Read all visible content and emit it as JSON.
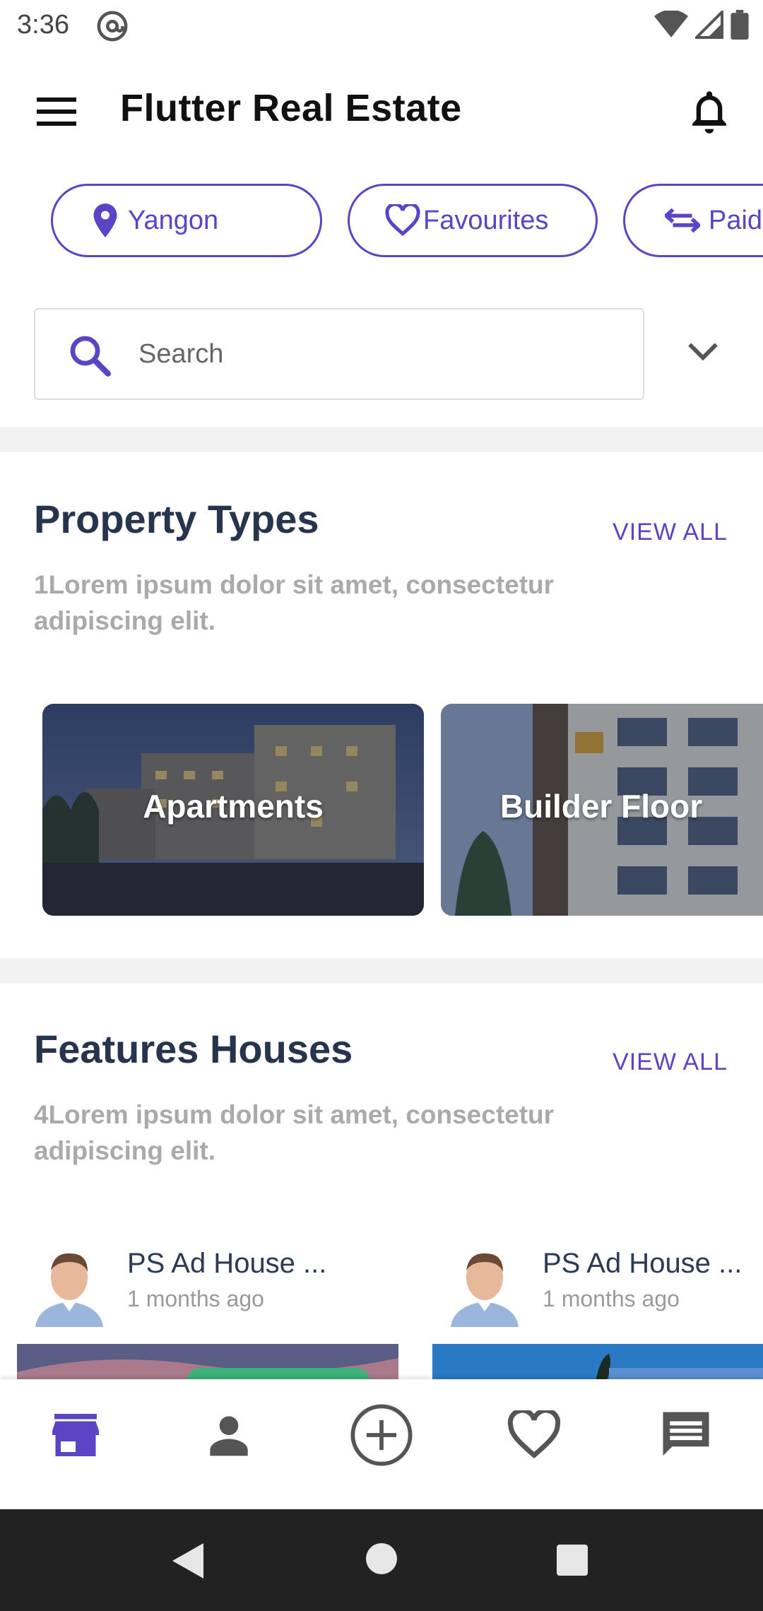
{
  "status_bar": {
    "time": "3:36"
  },
  "app_bar": {
    "title": "Flutter Real Estate"
  },
  "chips": [
    {
      "label": "Yangon",
      "icon": "location-pin-icon"
    },
    {
      "label": "Favourites",
      "icon": "heart-outline-icon"
    },
    {
      "label": "Paid",
      "icon": "swap-arrows-icon"
    }
  ],
  "search": {
    "placeholder": "Search"
  },
  "property_types": {
    "title": "Property Types",
    "view_all": "VIEW ALL",
    "subtitle": "1Lorem ipsum dolor sit amet, consectetur adipiscing elit.",
    "items": [
      {
        "label": "Apartments"
      },
      {
        "label": "Builder Floor"
      }
    ]
  },
  "features_houses": {
    "title": "Features Houses",
    "view_all": "VIEW ALL",
    "subtitle": "4Lorem ipsum dolor sit amet, consectetur adipiscing elit.",
    "items": [
      {
        "name": "PS Ad House ...",
        "time": "1 months ago"
      },
      {
        "name": "PS Ad House ...",
        "time": "1 months ago"
      }
    ]
  },
  "bottom_nav": [
    {
      "icon": "store-icon",
      "active": true
    },
    {
      "icon": "person-icon",
      "active": false
    },
    {
      "icon": "add-circle-icon",
      "active": false
    },
    {
      "icon": "heart-outline-icon",
      "active": false
    },
    {
      "icon": "chat-icon",
      "active": false
    }
  ],
  "colors": {
    "accent": "#5b44c6",
    "title": "#26344e",
    "subtitle": "#aaaaaa",
    "nav_inactive": "#555555"
  }
}
